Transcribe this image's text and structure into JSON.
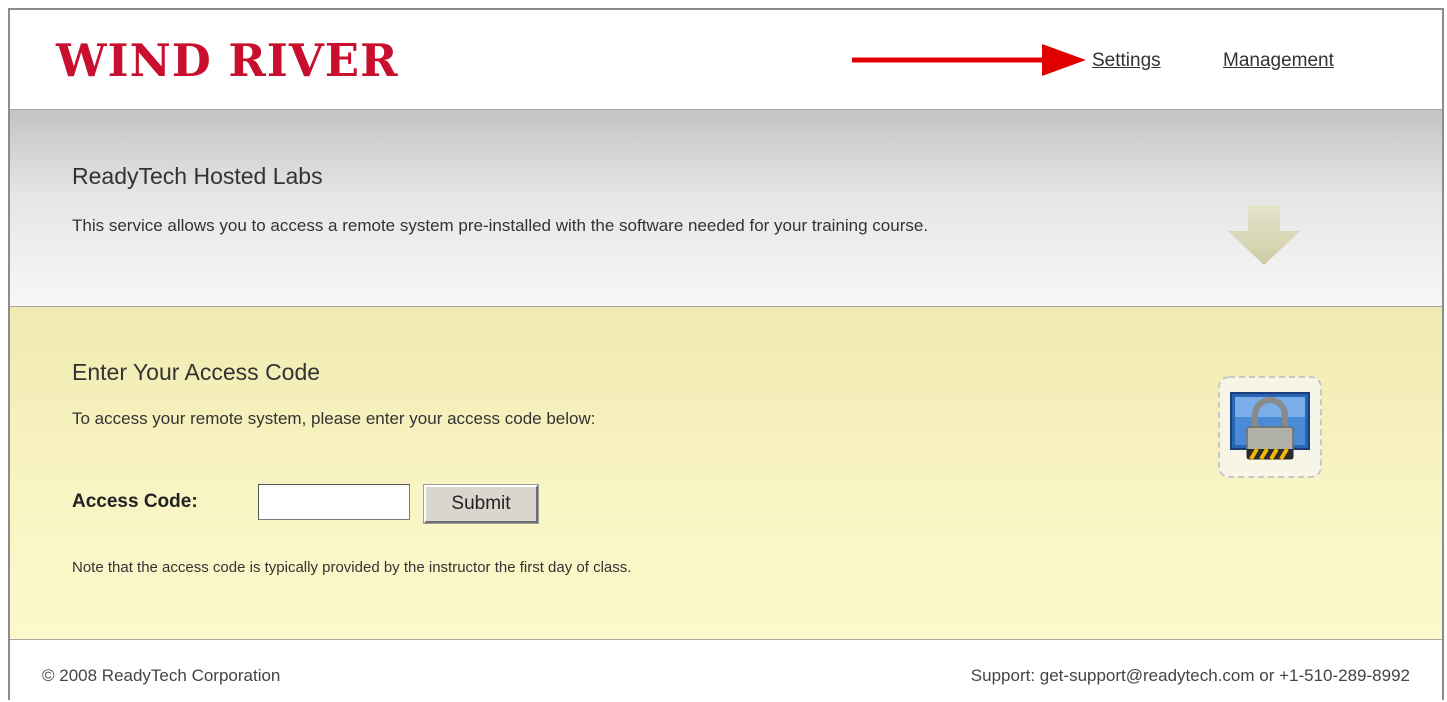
{
  "header": {
    "logo_text": "WIND RIVER",
    "nav": {
      "settings": "Settings",
      "management": "Management"
    },
    "annotation_arrow_color": "#e00000"
  },
  "intro": {
    "title": "ReadyTech Hosted Labs",
    "text": "This service allows you to access a remote system pre-installed with the software needed for your training course."
  },
  "access": {
    "title": "Enter Your Access Code",
    "text": "To access your remote system, please enter your access code below:",
    "code_label": "Access Code:",
    "code_value": "",
    "submit_label": "Submit",
    "note": "Note that the access code is typically provided by the instructor the first day of class."
  },
  "footer": {
    "copyright": "© 2008 ReadyTech Corporation",
    "support": "Support: get-support@readytech.com or +1-510-289-8992"
  },
  "colors": {
    "brand_red": "#c8102e",
    "access_bg": "#f8f3c2",
    "intro_bg": "#e6e6e6"
  },
  "icons": [
    "right-arrow-annotation-icon",
    "down-arrow-icon",
    "locked-monitor-icon"
  ]
}
